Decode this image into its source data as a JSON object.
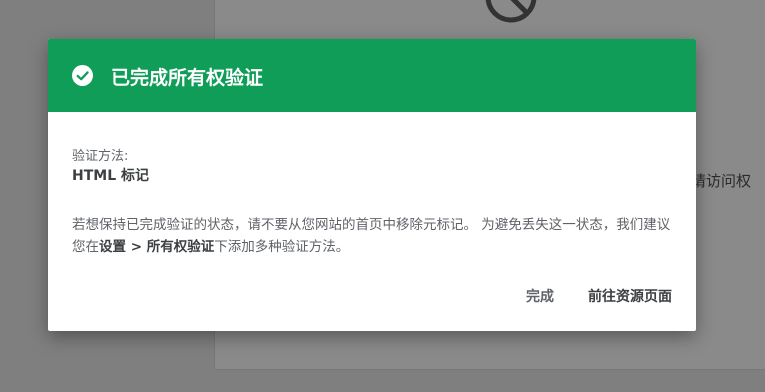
{
  "background": {
    "partial_text": "请访问权",
    "icon": "block-icon"
  },
  "dialog": {
    "icon": "check-circle-icon",
    "title": "已完成所有权验证",
    "method_label": "验证方法:",
    "method_value": "HTML 标记",
    "description_part1": "若想保持已完成验证的状态，请不要从您网站的首页中移除元标记。 为避免丢失这一状态，我们建议您在",
    "description_bold": "设置 > 所有权验证",
    "description_part2": "下添加多种验证方法。",
    "done_button": "完成",
    "goto_button": "前往资源页面",
    "header_color": "#0f9d58"
  }
}
